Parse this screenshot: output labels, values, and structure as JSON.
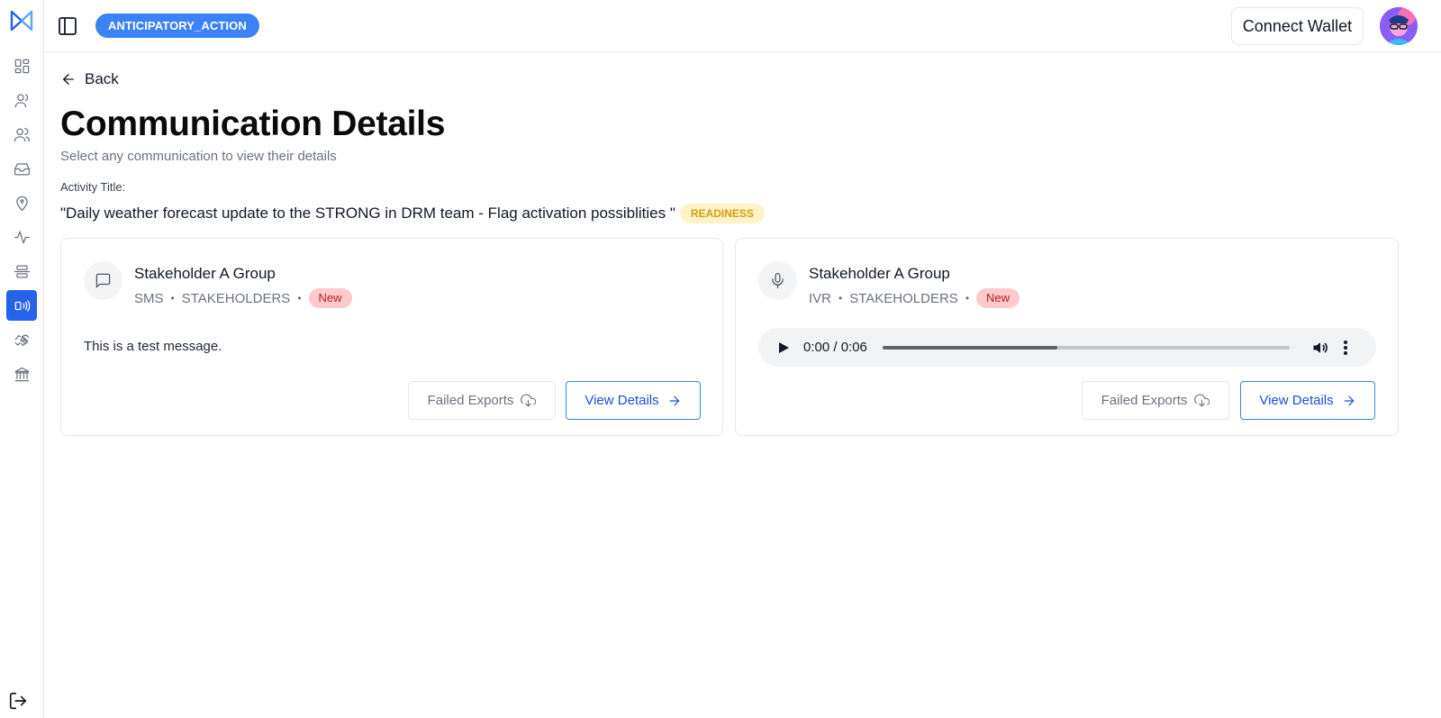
{
  "colors": {
    "primary": "#2563eb",
    "badge_blue": "#3b82f6",
    "readiness_bg": "#fef3c7",
    "readiness_text": "#d4a017",
    "new_bg": "#fecaca",
    "new_text": "#b91c1c"
  },
  "sidebar": {
    "logo_icon": "rahat-logo-icon",
    "items": [
      {
        "name": "dashboard",
        "icon": "dashboard-grid-icon",
        "active": false
      },
      {
        "name": "beneficiaries",
        "icon": "user-icon",
        "active": false
      },
      {
        "name": "groups",
        "icon": "users-icon",
        "active": false
      },
      {
        "name": "inbox",
        "icon": "inbox-tray-icon",
        "active": false
      },
      {
        "name": "locations",
        "icon": "map-pin-icon",
        "active": false
      },
      {
        "name": "activity",
        "icon": "activity-pulse-icon",
        "active": false
      },
      {
        "name": "align",
        "icon": "align-center-icon",
        "active": false
      },
      {
        "name": "communications",
        "icon": "broadcast-icon",
        "active": true
      },
      {
        "name": "handshake",
        "icon": "handshake-icon",
        "active": false
      },
      {
        "name": "bank",
        "icon": "bank-icon",
        "active": false
      }
    ],
    "logout_icon": "logout-icon"
  },
  "header": {
    "app_badge": "ANTICIPATORY_ACTION",
    "connect_wallet": "Connect Wallet"
  },
  "main": {
    "back_label": "Back",
    "title": "Communication Details",
    "subtitle": "Select any communication to view their details",
    "activity_label": "Activity Title:",
    "activity_title": "\"Daily weather forecast update to the STRONG in DRM team - Flag activation possiblities \"",
    "activity_tag": "READINESS"
  },
  "cards": [
    {
      "icon": "message-square-icon",
      "title": "Stakeholder A Group",
      "transport": "SMS",
      "audience": "STAKEHOLDERS",
      "dot": "•",
      "status": "New",
      "message": "This is a test message.",
      "failed_exports": "Failed Exports",
      "view_details": "View Details"
    },
    {
      "icon": "microphone-icon",
      "title": "Stakeholder A Group",
      "transport": "IVR",
      "audience": "STAKEHOLDERS",
      "dot": "•",
      "status": "New",
      "audio_time": "0:00 / 0:06",
      "audio_progress": 0.43,
      "failed_exports": "Failed Exports",
      "view_details": "View Details"
    }
  ]
}
